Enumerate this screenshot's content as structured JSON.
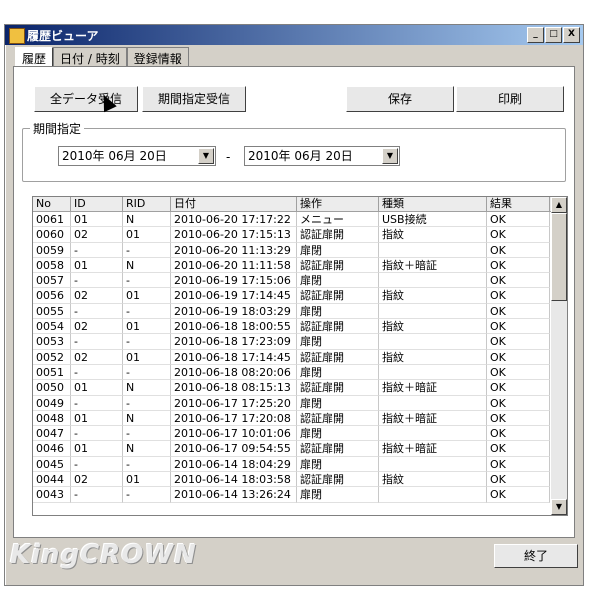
{
  "window": {
    "title": "履歴ビューア",
    "minimize": "_",
    "maximize": "□",
    "close": "X"
  },
  "tabs": [
    {
      "label": "履歴"
    },
    {
      "label": "日付 / 時刻"
    },
    {
      "label": "登録情報"
    }
  ],
  "toolbar": {
    "receive_all": "全データ受信",
    "receive_period": "期間指定受信",
    "save": "保存",
    "print": "印刷"
  },
  "period": {
    "label": "期間指定",
    "from": "2010年 06月 20日",
    "to": "2010年 06月 20日",
    "dash": "-"
  },
  "table": {
    "headers": [
      "No",
      "ID",
      "RID",
      "日付",
      "操作",
      "種類",
      "結果"
    ],
    "rows": [
      [
        "0061",
        "01",
        "N",
        "2010-06-20 17:17:22",
        "メニュー",
        "USB接続",
        "OK"
      ],
      [
        "0060",
        "02",
        "01",
        "2010-06-20 17:15:13",
        "認証扉開",
        "指紋",
        "OK"
      ],
      [
        "0059",
        "-",
        "-",
        "2010-06-20 11:13:29",
        "扉閉",
        "",
        "OK"
      ],
      [
        "0058",
        "01",
        "N",
        "2010-06-20 11:11:58",
        "認証扉開",
        "指紋＋暗証",
        "OK"
      ],
      [
        "0057",
        "-",
        "-",
        "2010-06-19 17:15:06",
        "扉閉",
        "",
        "OK"
      ],
      [
        "0056",
        "02",
        "01",
        "2010-06-19 17:14:45",
        "認証扉開",
        "指紋",
        "OK"
      ],
      [
        "0055",
        "-",
        "-",
        "2010-06-19 18:03:29",
        "扉閉",
        "",
        "OK"
      ],
      [
        "0054",
        "02",
        "01",
        "2010-06-18 18:00:55",
        "認証扉開",
        "指紋",
        "OK"
      ],
      [
        "0053",
        "-",
        "-",
        "2010-06-18 17:23:09",
        "扉閉",
        "",
        "OK"
      ],
      [
        "0052",
        "02",
        "01",
        "2010-06-18 17:14:45",
        "認証扉開",
        "指紋",
        "OK"
      ],
      [
        "0051",
        "-",
        "-",
        "2010-06-18 08:20:06",
        "扉閉",
        "",
        "OK"
      ],
      [
        "0050",
        "01",
        "N",
        "2010-06-18 08:15:13",
        "認証扉開",
        "指紋＋暗証",
        "OK"
      ],
      [
        "0049",
        "-",
        "-",
        "2010-06-17 17:25:20",
        "扉閉",
        "",
        "OK"
      ],
      [
        "0048",
        "01",
        "N",
        "2010-06-17 17:20:08",
        "認証扉開",
        "指紋＋暗証",
        "OK"
      ],
      [
        "0047",
        "-",
        "-",
        "2010-06-17 10:01:06",
        "扉閉",
        "",
        "OK"
      ],
      [
        "0046",
        "01",
        "N",
        "2010-06-17 09:54:55",
        "認証扉開",
        "指紋＋暗証",
        "OK"
      ],
      [
        "0045",
        "-",
        "-",
        "2010-06-14 18:04:29",
        "扉閉",
        "",
        "OK"
      ],
      [
        "0044",
        "02",
        "01",
        "2010-06-14 18:03:58",
        "認証扉開",
        "指紋",
        "OK"
      ],
      [
        "0043",
        "-",
        "-",
        "2010-06-14 13:26:24",
        "扉閉",
        "",
        "OK"
      ]
    ]
  },
  "footer": {
    "logo": "KingCROWN",
    "exit": "終了"
  },
  "icons": {
    "scroll_up": "▲",
    "scroll_down": "▼",
    "combo_arrow": "▼"
  }
}
